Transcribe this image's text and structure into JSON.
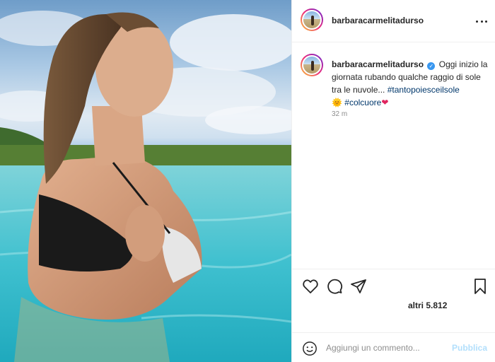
{
  "post": {
    "image_alt": "Woman in bikini standing in an infinity pool under a cloudy blue sky"
  },
  "header": {
    "username": "barbaracarmelitadurso",
    "more_icon": "more-horizontal-icon"
  },
  "caption": {
    "username": "barbaracarmelitadurso",
    "verified": true,
    "text_1": "Oggi inizio la giornata rubando qualche raggio di sole tra le nuvole...",
    "hashtag_1": "#tantopoiesceilsole",
    "emoji_1": "🌞",
    "hashtag_2": "#colcuore",
    "emoji_2": "❤",
    "timestamp": "32 m"
  },
  "actions": {
    "icons": [
      "heart-icon",
      "comment-icon",
      "share-icon",
      "bookmark-icon"
    ],
    "likes_label": "altri 5.812"
  },
  "comment": {
    "placeholder": "Aggiungi un commento...",
    "publish_label": "Pubblica"
  },
  "colors": {
    "accent": "#0095f6",
    "publish_disabled": "#b2dffc",
    "hashtag": "#00376b",
    "muted": "#8e8e8e"
  }
}
